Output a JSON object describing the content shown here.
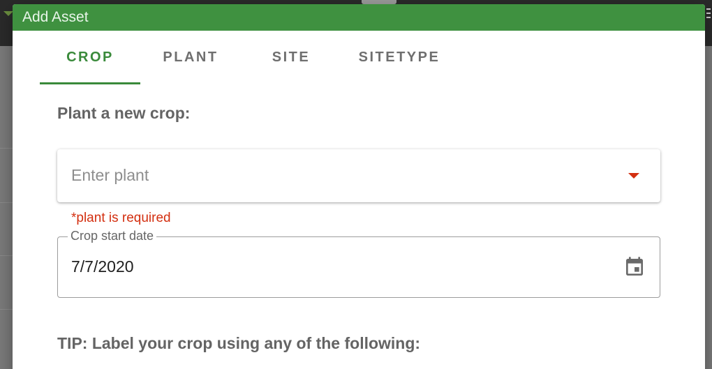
{
  "dialog": {
    "title": "Add Asset"
  },
  "tabs": [
    {
      "label": "CROP",
      "active": true
    },
    {
      "label": "PLANT",
      "active": false
    },
    {
      "label": "SITE",
      "active": false
    },
    {
      "label": "SITETYPE",
      "active": false
    }
  ],
  "crop_form": {
    "heading": "Plant a new crop:",
    "plant_select": {
      "placeholder": "Enter plant",
      "error": "*plant is required"
    },
    "start_date": {
      "label": "Crop start date",
      "value": "7/7/2020"
    },
    "tip": "TIP: Label your crop using any of the following:"
  },
  "colors": {
    "header_green": "#3f9140",
    "accent_green": "#3a8a3b",
    "error_red": "#d32f10",
    "muted_text": "#646464"
  },
  "icons": {
    "calendar": "calendar-icon",
    "dropdown": "caret-down-icon"
  }
}
